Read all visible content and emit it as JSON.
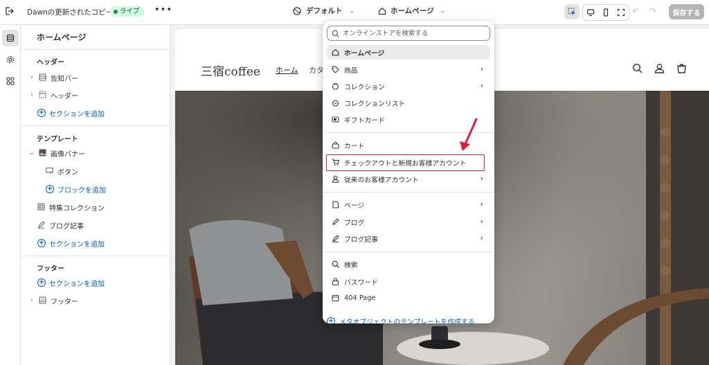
{
  "topbar": {
    "theme_name": "Dawnの更新されたコピー",
    "live_label": "ライブ",
    "more_label": "•••",
    "preset_label": "デフォルト",
    "page_label": "ホームページ",
    "save_label": "保存する"
  },
  "sidebar": {
    "title": "ホームページ",
    "header_group": {
      "heading": "ヘッダー",
      "items": [
        "告知バー",
        "ヘッダー"
      ],
      "add_label": "セクションを追加"
    },
    "template_group": {
      "heading": "テンプレート",
      "banner_label": "画像バナー",
      "button_label": "ボタン",
      "add_block_label": "ブロックを追加",
      "featured_label": "特集コレクション",
      "blog_label": "ブログ記事",
      "add_label": "セクションを追加"
    },
    "footer_group": {
      "heading": "フッター",
      "add_label": "セクションを追加",
      "footer_label": "フッター"
    }
  },
  "preview": {
    "logo": "三宿coffee",
    "nav_home": "ホーム",
    "nav_cat": "カタ"
  },
  "dropdown": {
    "search_placeholder": "オンラインストアを検索する",
    "group1": [
      "ホームページ",
      "商品",
      "コレクション",
      "コレクションリスト",
      "ギフトカード"
    ],
    "group2": [
      "カート",
      "チェックアウトと新規お客様アカウント",
      "従来のお客様アカウント"
    ],
    "group3": [
      "ページ",
      "ブログ",
      "ブログ記事"
    ],
    "group4": [
      "検索",
      "パスワード",
      "404 Page"
    ],
    "footer_label": "メタオブジェクトのテンプレートを作成する"
  },
  "colors": {
    "accent_blue": "#005bd3",
    "highlight_red": "#e21b3c",
    "live_green": "#cdfee1"
  }
}
